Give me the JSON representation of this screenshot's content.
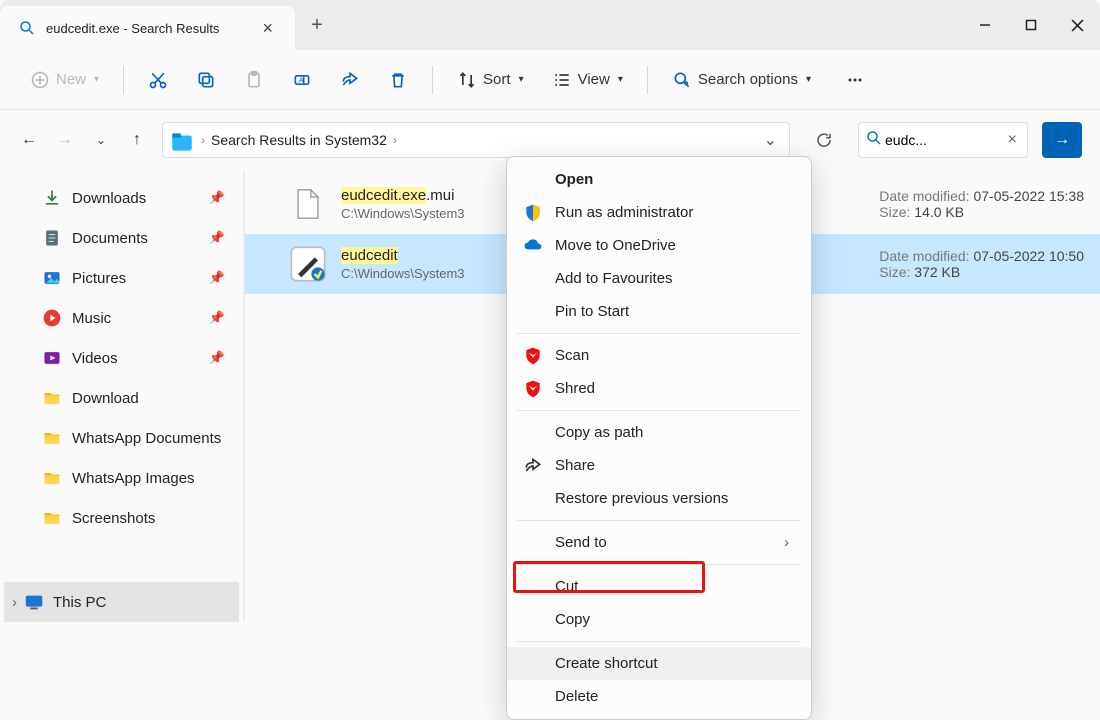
{
  "tab": {
    "title": "eudcedit.exe - Search Results"
  },
  "toolbar": {
    "new": "New",
    "sort": "Sort",
    "view": "View",
    "search_options": "Search options"
  },
  "breadcrumb": {
    "text": "Search Results in System32"
  },
  "search": {
    "value": "eudc..."
  },
  "sidebar": {
    "items": [
      {
        "label": "Downloads",
        "icon": "download"
      },
      {
        "label": "Documents",
        "icon": "document"
      },
      {
        "label": "Pictures",
        "icon": "pictures"
      },
      {
        "label": "Music",
        "icon": "music"
      },
      {
        "label": "Videos",
        "icon": "videos"
      },
      {
        "label": "Download",
        "icon": "folder"
      },
      {
        "label": "WhatsApp Documents",
        "icon": "folder"
      },
      {
        "label": "WhatsApp Images",
        "icon": "folder"
      },
      {
        "label": "Screenshots",
        "icon": "folder"
      }
    ],
    "this_pc": "This PC"
  },
  "results": [
    {
      "name_hl": "eudcedit.exe",
      "name_rest": ".mui",
      "path": "C:\\Windows\\System3",
      "date_label": "Date modified:",
      "date": "07-05-2022 15:38",
      "size_label": "Size:",
      "size": "14.0 KB"
    },
    {
      "name_hl": "eudcedit",
      "name_rest": "",
      "path": "C:\\Windows\\System3",
      "date_label": "Date modified:",
      "date": "07-05-2022 10:50",
      "size_label": "Size:",
      "size": "372 KB"
    }
  ],
  "context_menu": {
    "open": "Open",
    "run_admin": "Run as administrator",
    "onedrive": "Move to OneDrive",
    "favourites": "Add to Favourites",
    "pin_start": "Pin to Start",
    "scan": "Scan",
    "shred": "Shred",
    "copy_path": "Copy as path",
    "share": "Share",
    "restore": "Restore previous versions",
    "send_to": "Send to",
    "cut": "Cut",
    "copy": "Copy",
    "create_shortcut": "Create shortcut",
    "delete": "Delete"
  }
}
